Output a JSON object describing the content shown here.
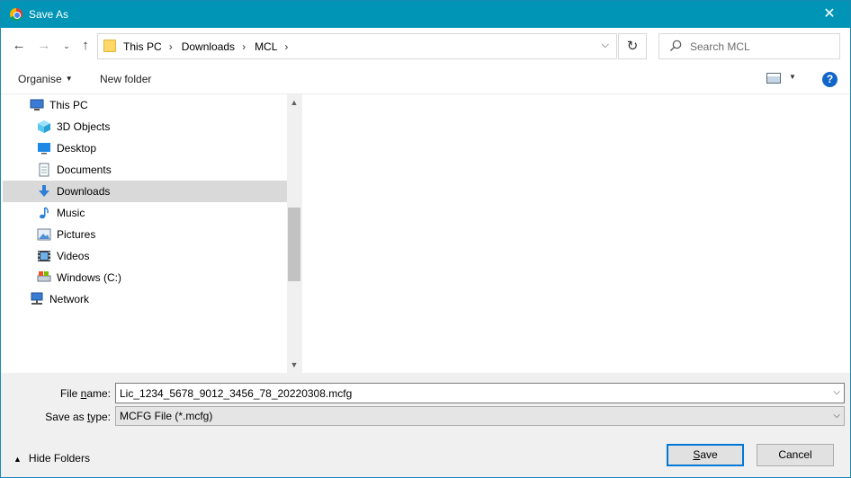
{
  "window": {
    "title": "Save As"
  },
  "address": {
    "crumbs": [
      "This PC",
      "Downloads",
      "MCL"
    ],
    "refresh_glyph": "↻"
  },
  "search": {
    "placeholder": "Search MCL"
  },
  "toolbar": {
    "organise_label": "Organise",
    "new_folder_label": "New folder",
    "help_glyph": "?"
  },
  "nav": {
    "items": [
      {
        "label": "This PC",
        "icon": "this-pc-icon",
        "selected": false,
        "indent": 0
      },
      {
        "label": "3D Objects",
        "icon": "3d-objects-icon",
        "selected": false,
        "indent": 1
      },
      {
        "label": "Desktop",
        "icon": "desktop-icon",
        "selected": false,
        "indent": 1
      },
      {
        "label": "Documents",
        "icon": "documents-icon",
        "selected": false,
        "indent": 1
      },
      {
        "label": "Downloads",
        "icon": "downloads-icon",
        "selected": true,
        "indent": 1
      },
      {
        "label": "Music",
        "icon": "music-icon",
        "selected": false,
        "indent": 1
      },
      {
        "label": "Pictures",
        "icon": "pictures-icon",
        "selected": false,
        "indent": 1
      },
      {
        "label": "Videos",
        "icon": "videos-icon",
        "selected": false,
        "indent": 1
      },
      {
        "label": "Windows  (C:)",
        "icon": "drive-icon",
        "selected": false,
        "indent": 1
      },
      {
        "label": "Network",
        "icon": "network-icon",
        "selected": false,
        "indent": 0
      }
    ]
  },
  "form": {
    "file_name_label_pre": "File ",
    "file_name_label_ul": "n",
    "file_name_label_post": "ame:",
    "file_name_value": "Lic_1234_5678_9012_3456_78_20220308.mcfg",
    "save_type_label_pre": "Save as ",
    "save_type_label_ul": "t",
    "save_type_label_post": "ype:",
    "save_type_value": "MCFG File (*.mcfg)"
  },
  "footer": {
    "hide_folders_label": "Hide Folders",
    "save_label_ul": "S",
    "save_label_post": "ave",
    "cancel_label": "Cancel"
  },
  "colors": {
    "titlebar": "#0095b6",
    "selection": "#d9d9d9",
    "accent": "#0078d7"
  }
}
